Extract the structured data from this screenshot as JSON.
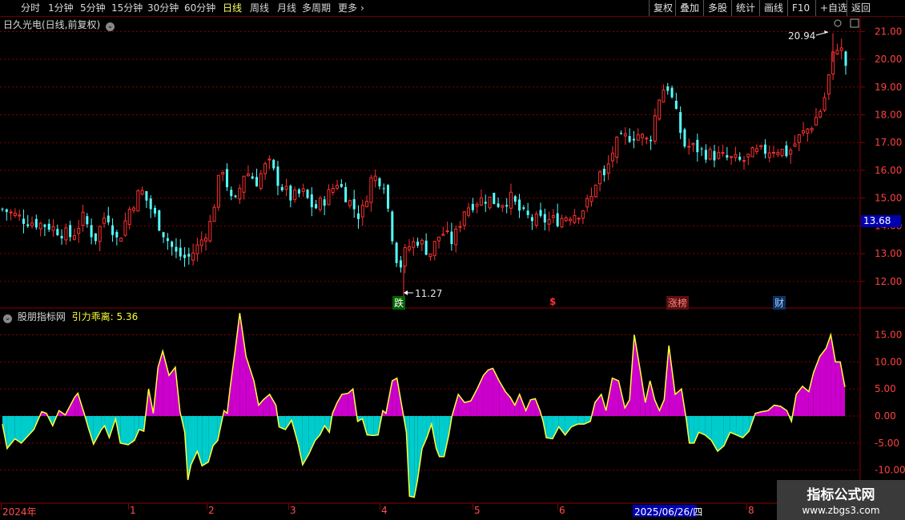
{
  "toolbar": {
    "periods": [
      "分时",
      "1分钟",
      "5分钟",
      "15分钟",
      "30分钟",
      "60分钟",
      "日线",
      "周线",
      "月线",
      "多周期",
      "更多"
    ],
    "active_period": "日线",
    "more_arrow": "›",
    "right_buttons": [
      "复权",
      "叠加",
      "多股",
      "统计",
      "画线",
      "F10",
      "+自选",
      "返回"
    ]
  },
  "main_panel": {
    "title": "日久光电(日线,前复权)",
    "high_marker": "20.94",
    "low_marker": "11.27",
    "current_price": "13.68",
    "price_axis": [
      "21.00",
      "20.00",
      "19.00",
      "18.00",
      "17.00",
      "16.00",
      "15.00",
      "14.00",
      "13.00",
      "12.00"
    ],
    "event_tags": [
      {
        "text": "跌",
        "color": "#00c000"
      },
      {
        "text": "$",
        "color": "#ff3030"
      },
      {
        "text": "涨榜",
        "color": "#ff6060"
      },
      {
        "text": "财",
        "color": "#4da6ff"
      }
    ],
    "colors": {
      "up": "#ff3030",
      "down": "#54ffff",
      "grid": "#8a0000"
    }
  },
  "indicator_panel": {
    "name": "股朋指标网",
    "series_label": "引力乖离:",
    "series_value": "5.36",
    "axis": [
      "15.00",
      "10.00",
      "5.00",
      "0.00",
      "-5.00",
      "-10.00"
    ],
    "colors": {
      "positive": "#cc00cc",
      "negative": "#00cccc",
      "line": "#ffff33"
    }
  },
  "date_axis": {
    "labels": [
      "2024年",
      "1",
      "2",
      "3",
      "4",
      "5",
      "6",
      "8"
    ],
    "cursor_date": "2025/06/26/四"
  },
  "watermark": {
    "line1": "指标公式网",
    "line2": "www.zbgs3.com"
  },
  "chart_data": {
    "type": "candlestick",
    "title": "日久光电(日线,前复权)",
    "ylim": [
      11.1,
      21.5
    ],
    "marked_high": 20.94,
    "marked_low": 11.27,
    "last_price": 13.68,
    "close_trend": [
      [
        0,
        14.6
      ],
      [
        10,
        14.2
      ],
      [
        20,
        14.0
      ],
      [
        30,
        13.6
      ],
      [
        35,
        14.3
      ],
      [
        40,
        13.5
      ],
      [
        45,
        14.5
      ],
      [
        50,
        13.4
      ],
      [
        55,
        14.6
      ],
      [
        60,
        15.3
      ],
      [
        65,
        14.5
      ],
      [
        70,
        13.7
      ],
      [
        75,
        13.0
      ],
      [
        80,
        12.8
      ],
      [
        85,
        13.3
      ],
      [
        90,
        14.1
      ],
      [
        95,
        16.2
      ],
      [
        100,
        14.6
      ],
      [
        105,
        16.0
      ],
      [
        110,
        15.6
      ],
      [
        115,
        16.3
      ],
      [
        120,
        15.5
      ],
      [
        125,
        15.0
      ],
      [
        130,
        15.2
      ],
      [
        135,
        14.6
      ],
      [
        140,
        15.0
      ],
      [
        145,
        15.6
      ],
      [
        150,
        14.9
      ],
      [
        155,
        14.3
      ],
      [
        160,
        15.8
      ],
      [
        165,
        15.6
      ],
      [
        170,
        13.0
      ],
      [
        172,
        12.5
      ],
      [
        175,
        13.2
      ],
      [
        180,
        13.5
      ],
      [
        185,
        13.0
      ],
      [
        190,
        13.8
      ],
      [
        195,
        13.4
      ],
      [
        200,
        14.6
      ],
      [
        205,
        14.9
      ],
      [
        210,
        15.0
      ],
      [
        215,
        14.8
      ],
      [
        220,
        15.0
      ],
      [
        225,
        14.4
      ],
      [
        230,
        14.2
      ],
      [
        235,
        14.2
      ],
      [
        240,
        14.2
      ],
      [
        245,
        14.4
      ],
      [
        250,
        14.5
      ],
      [
        255,
        15.0
      ],
      [
        258,
        16.0
      ],
      [
        260,
        15.6
      ],
      [
        265,
        16.9
      ],
      [
        270,
        17.2
      ],
      [
        275,
        17.3
      ],
      [
        280,
        17.0
      ],
      [
        285,
        18.9
      ],
      [
        288,
        19.0
      ],
      [
        290,
        18.5
      ],
      [
        295,
        16.9
      ],
      [
        300,
        16.8
      ],
      [
        305,
        16.6
      ],
      [
        310,
        16.5
      ],
      [
        315,
        16.4
      ],
      [
        320,
        16.3
      ],
      [
        325,
        16.6
      ],
      [
        330,
        16.7
      ],
      [
        335,
        16.8
      ],
      [
        340,
        16.6
      ],
      [
        345,
        17.2
      ],
      [
        350,
        17.6
      ],
      [
        355,
        18.3
      ],
      [
        358,
        19.5
      ],
      [
        360,
        20.3
      ],
      [
        362,
        20.6
      ],
      [
        365,
        19.8
      ]
    ],
    "indicator": {
      "name": "引力乖离",
      "last": 5.36,
      "ylim": [
        -15.8,
        19.5
      ],
      "values": [
        [
          0,
          -1.5
        ],
        [
          3,
          -6.0
        ],
        [
          8,
          -4.2
        ],
        [
          12,
          -5.0
        ],
        [
          20,
          -2.5
        ],
        [
          25,
          0.8
        ],
        [
          28,
          0.5
        ],
        [
          32,
          -1.8
        ],
        [
          36,
          1.0
        ],
        [
          40,
          0.2
        ],
        [
          46,
          3.5
        ],
        [
          48,
          4.2
        ],
        [
          52,
          0.5
        ],
        [
          55,
          -2.5
        ],
        [
          58,
          -5.2
        ],
        [
          63,
          -2.5
        ],
        [
          65,
          -1.8
        ],
        [
          68,
          -4.0
        ],
        [
          72,
          -0.5
        ],
        [
          75,
          -5.0
        ],
        [
          80,
          -5.3
        ],
        [
          84,
          -4.5
        ],
        [
          87,
          -2.5
        ],
        [
          90,
          -2.8
        ],
        [
          93,
          5.0
        ],
        [
          96,
          0.5
        ],
        [
          99,
          9.0
        ],
        [
          102,
          12.0
        ],
        [
          106,
          7.5
        ],
        [
          110,
          9.0
        ],
        [
          113,
          0.8
        ],
        [
          116,
          -3.0
        ],
        [
          118,
          -11.8
        ],
        [
          120,
          -9.0
        ],
        [
          124,
          -6.5
        ],
        [
          127,
          -9.2
        ],
        [
          131,
          -8.5
        ],
        [
          134,
          -5.5
        ],
        [
          137,
          -4.5
        ],
        [
          141,
          1.0
        ],
        [
          143,
          0.5
        ],
        [
          145,
          5.5
        ],
        [
          148,
          12.0
        ],
        [
          151,
          19.0
        ],
        [
          155,
          11.0
        ],
        [
          160,
          6.5
        ],
        [
          163,
          2.0
        ],
        [
          166,
          3.0
        ],
        [
          170,
          4.0
        ],
        [
          174,
          2.0
        ],
        [
          176,
          -2.0
        ],
        [
          180,
          -2.5
        ],
        [
          184,
          -0.8
        ],
        [
          188,
          -5.0
        ],
        [
          191,
          -9.0
        ],
        [
          195,
          -7.0
        ],
        [
          199,
          -4.5
        ],
        [
          202,
          -3.5
        ],
        [
          205,
          -1.8
        ],
        [
          208,
          -3.0
        ],
        [
          210,
          0.5
        ],
        [
          213,
          2.5
        ],
        [
          216,
          4.0
        ],
        [
          220,
          4.2
        ],
        [
          223,
          5.0
        ],
        [
          226,
          -1.0
        ],
        [
          229,
          -0.5
        ],
        [
          232,
          -3.5
        ],
        [
          236,
          -3.6
        ],
        [
          239,
          -3.5
        ],
        [
          242,
          1.0
        ],
        [
          244,
          0.5
        ],
        [
          248,
          6.5
        ],
        [
          251,
          7.0
        ],
        [
          254,
          2.0
        ],
        [
          257,
          -3.0
        ],
        [
          259,
          -14.8
        ],
        [
          262,
          -15.0
        ],
        [
          264,
          -12.0
        ],
        [
          267,
          -6.0
        ],
        [
          270,
          -4.0
        ],
        [
          273,
          -1.5
        ],
        [
          276,
          -6.0
        ],
        [
          278,
          -7.5
        ],
        [
          281,
          -7.5
        ],
        [
          284,
          -3.5
        ],
        [
          286,
          0.0
        ],
        [
          290,
          4.0
        ],
        [
          294,
          2.5
        ],
        [
          298,
          2.8
        ],
        [
          302,
          5.0
        ],
        [
          306,
          7.5
        ],
        [
          309,
          8.5
        ],
        [
          312,
          8.8
        ],
        [
          316,
          6.5
        ],
        [
          320,
          4.5
        ],
        [
          323,
          3.5
        ],
        [
          326,
          2.0
        ],
        [
          329,
          4.0
        ],
        [
          333,
          1.0
        ],
        [
          336,
          3.0
        ],
        [
          339,
          3.2
        ],
        [
          342,
          1.0
        ],
        [
          344,
          -1.0
        ],
        [
          346,
          -4.0
        ],
        [
          350,
          -4.2
        ],
        [
          354,
          -2.0
        ],
        [
          358,
          -3.5
        ],
        [
          362,
          -2.0
        ],
        [
          366,
          -1.5
        ],
        [
          370,
          -1.5
        ],
        [
          374,
          -1.0
        ],
        [
          377,
          2.5
        ],
        [
          381,
          4.0
        ],
        [
          384,
          1.0
        ],
        [
          388,
          7.0
        ],
        [
          392,
          6.5
        ],
        [
          396,
          1.5
        ],
        [
          399,
          3.0
        ],
        [
          402,
          15.0
        ],
        [
          406,
          8.0
        ],
        [
          409,
          2.5
        ],
        [
          412,
          6.5
        ],
        [
          415,
          3.0
        ],
        [
          418,
          1.0
        ],
        [
          421,
          3.0
        ],
        [
          424,
          13.0
        ],
        [
          428,
          4.0
        ],
        [
          432,
          5.0
        ],
        [
          435,
          -0.5
        ],
        [
          437,
          -5.0
        ],
        [
          440,
          -5.0
        ],
        [
          443,
          -3.0
        ],
        [
          447,
          -3.5
        ],
        [
          451,
          -4.5
        ],
        [
          455,
          -6.5
        ],
        [
          459,
          -5.5
        ],
        [
          463,
          -3.0
        ],
        [
          467,
          -3.5
        ],
        [
          471,
          -4.0
        ],
        [
          475,
          -2.8
        ],
        [
          479,
          0.5
        ],
        [
          483,
          0.8
        ],
        [
          487,
          1.0
        ],
        [
          491,
          2.0
        ],
        [
          495,
          1.8
        ],
        [
          499,
          1.0
        ],
        [
          502,
          -1.0
        ],
        [
          505,
          4.0
        ],
        [
          509,
          5.5
        ],
        [
          513,
          4.5
        ],
        [
          516,
          8.0
        ],
        [
          520,
          11.0
        ],
        [
          524,
          12.5
        ],
        [
          527,
          15.0
        ],
        [
          530,
          10.0
        ],
        [
          533,
          10.0
        ],
        [
          536,
          5.36
        ]
      ]
    }
  }
}
